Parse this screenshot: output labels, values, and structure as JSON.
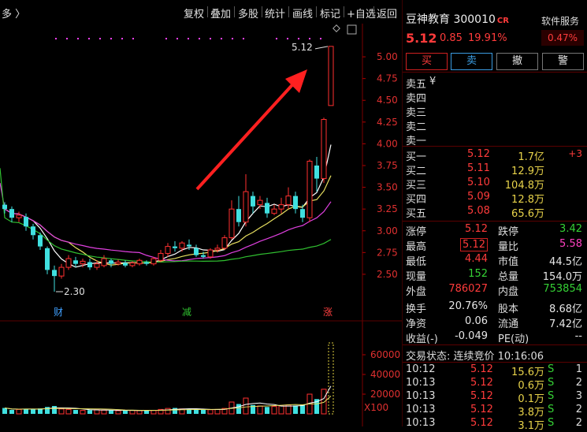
{
  "toolbar": {
    "left_label": "多 〉",
    "buttons": [
      "复权",
      "叠加",
      "多股",
      "统计",
      "画线",
      "标记",
      "+自选",
      "返回"
    ]
  },
  "stock": {
    "name": "豆神教育",
    "code": "300010",
    "badge": "CR",
    "price": "5.12",
    "change": "0.85",
    "change_pct": "19.91%",
    "service_label": "软件服务",
    "service_pct": "0.47%"
  },
  "trade_buttons": {
    "buy": "买",
    "sell": "卖",
    "cancel": "撤",
    "alert": "警"
  },
  "asks": [
    {
      "label": "卖五",
      "extra": "¥"
    },
    {
      "label": "卖四",
      "extra": ""
    },
    {
      "label": "卖三",
      "extra": ""
    },
    {
      "label": "卖二",
      "extra": ""
    },
    {
      "label": "卖一",
      "extra": ""
    }
  ],
  "bids": [
    {
      "label": "买一",
      "price": "5.12",
      "vol": "1.7亿",
      "delta": "+3"
    },
    {
      "label": "买二",
      "price": "5.11",
      "vol": "12.9万",
      "delta": ""
    },
    {
      "label": "买三",
      "price": "5.10",
      "vol": "104.8万",
      "delta": ""
    },
    {
      "label": "买四",
      "price": "5.09",
      "vol": "12.8万",
      "delta": ""
    },
    {
      "label": "买五",
      "price": "5.08",
      "vol": "65.6万",
      "delta": ""
    }
  ],
  "stats": [
    {
      "l1": "涨停",
      "v1": "5.12",
      "l2": "跌停",
      "v2": "3.42"
    },
    {
      "l1": "最高",
      "v1": "5.12",
      "l2": "量比",
      "v2": "5.58"
    },
    {
      "l1": "最低",
      "v1": "4.44",
      "l2": "市值",
      "v2": "44.5亿"
    },
    {
      "l1": "现量",
      "v1": "152",
      "l2": "总量",
      "v2": "154.0万"
    },
    {
      "l1": "外盘",
      "v1": "786027",
      "l2": "内盘",
      "v2": "753854"
    },
    {
      "l1": "换手",
      "v1": "20.76%",
      "l2": "股本",
      "v2": "8.68亿"
    },
    {
      "l1": "净资",
      "v1": "0.06",
      "l2": "流通",
      "v2": "7.42亿"
    },
    {
      "l1": "收益(-)",
      "v1": "-0.049",
      "l2": "PE(动)",
      "v2": "--"
    }
  ],
  "trade_status": "交易状态: 连续竞价 10:16:06",
  "ticks": [
    {
      "time": "10:12",
      "price": "5.12",
      "vol": "15.6万",
      "side": "S",
      "n": "1"
    },
    {
      "time": "10:13",
      "price": "5.12",
      "vol": "0.6万",
      "side": "S",
      "n": "2"
    },
    {
      "time": "10:13",
      "price": "5.12",
      "vol": "0.1万",
      "side": "S",
      "n": "3"
    },
    {
      "time": "10:13",
      "price": "5.12",
      "vol": "3.8万",
      "side": "S",
      "n": "2"
    },
    {
      "time": "10:13",
      "price": "5.12",
      "vol": "3.1万",
      "side": "S",
      "n": "2"
    }
  ],
  "chart_data": {
    "type": "candlestick",
    "price_axis": {
      "ticks": [
        "5.00",
        "4.75",
        "4.50",
        "4.25",
        "4.00",
        "3.75",
        "3.50",
        "3.25",
        "3.00",
        "2.75",
        "2.50"
      ],
      "range": [
        2.3,
        5.2
      ]
    },
    "volume_axis": {
      "ticks": [
        "60000",
        "40000",
        "20000"
      ],
      "unit_label": "X100",
      "range": [
        0,
        80000
      ]
    },
    "annotations": {
      "high_label": "5.12",
      "low_label": "2.30",
      "markers": [
        "财",
        "减",
        "涨"
      ]
    },
    "candles": [
      [
        3.3,
        3.25,
        3.33,
        3.2
      ],
      [
        3.25,
        3.15,
        3.28,
        3.1
      ],
      [
        3.15,
        3.18,
        3.22,
        3.1
      ],
      [
        3.16,
        3.05,
        3.2,
        3.0
      ],
      [
        3.05,
        2.95,
        3.08,
        2.9
      ],
      [
        2.95,
        2.82,
        2.98,
        2.78
      ],
      [
        2.8,
        2.55,
        2.82,
        2.5
      ],
      [
        2.55,
        2.48,
        2.6,
        2.3
      ],
      [
        2.48,
        2.58,
        2.62,
        2.45
      ],
      [
        2.58,
        2.68,
        2.72,
        2.55
      ],
      [
        2.66,
        2.62,
        2.7,
        2.58
      ],
      [
        2.62,
        2.65,
        2.68,
        2.58
      ],
      [
        2.64,
        2.58,
        2.68,
        2.55
      ],
      [
        2.58,
        2.62,
        2.66,
        2.55
      ],
      [
        2.6,
        2.68,
        2.72,
        2.58
      ],
      [
        2.66,
        2.62,
        2.68,
        2.58
      ],
      [
        2.62,
        2.64,
        2.67,
        2.6
      ],
      [
        2.63,
        2.6,
        2.66,
        2.58
      ],
      [
        2.6,
        2.63,
        2.65,
        2.58
      ],
      [
        2.62,
        2.66,
        2.68,
        2.6
      ],
      [
        2.64,
        2.62,
        2.66,
        2.6
      ],
      [
        2.62,
        2.68,
        2.7,
        2.6
      ],
      [
        2.66,
        2.74,
        2.78,
        2.64
      ],
      [
        2.74,
        2.82,
        2.86,
        2.7
      ],
      [
        2.82,
        2.8,
        2.88,
        2.76
      ],
      [
        2.8,
        2.86,
        2.88,
        2.76
      ],
      [
        2.84,
        2.82,
        2.9,
        2.78
      ],
      [
        2.8,
        2.72,
        2.84,
        2.7
      ],
      [
        2.72,
        2.7,
        2.76,
        2.68
      ],
      [
        2.7,
        2.78,
        2.8,
        2.68
      ],
      [
        2.78,
        2.8,
        2.84,
        2.75
      ],
      [
        2.8,
        2.92,
        2.95,
        2.78
      ],
      [
        2.92,
        3.25,
        3.35,
        2.9
      ],
      [
        3.25,
        3.1,
        3.4,
        3.05
      ],
      [
        3.1,
        3.45,
        3.65,
        3.05
      ],
      [
        3.4,
        3.28,
        3.45,
        3.2
      ],
      [
        3.3,
        3.35,
        3.4,
        3.25
      ],
      [
        3.32,
        3.2,
        3.38,
        3.15
      ],
      [
        3.2,
        3.25,
        3.3,
        3.18
      ],
      [
        3.25,
        3.3,
        3.38,
        3.2
      ],
      [
        3.3,
        3.4,
        3.5,
        3.25
      ],
      [
        3.4,
        3.25,
        3.45,
        3.2
      ],
      [
        3.25,
        3.15,
        3.3,
        3.1
      ],
      [
        3.15,
        3.8,
        3.82,
        3.1
      ],
      [
        3.75,
        3.6,
        3.85,
        3.45
      ],
      [
        3.6,
        4.28,
        4.3,
        3.55
      ],
      [
        4.44,
        5.12,
        5.12,
        4.44
      ]
    ],
    "volumes": [
      6000,
      4000,
      4500,
      5000,
      4800,
      5500,
      7000,
      8000,
      5000,
      4500,
      4000,
      3500,
      3800,
      4200,
      3800,
      3500,
      3200,
      3500,
      3600,
      3400,
      3300,
      3500,
      4500,
      5500,
      6000,
      5000,
      4800,
      4500,
      4000,
      4200,
      4500,
      5500,
      12000,
      10000,
      16000,
      9000,
      8000,
      7000,
      7500,
      8000,
      9000,
      8500,
      9000,
      20000,
      15000,
      25000,
      72000
    ]
  }
}
